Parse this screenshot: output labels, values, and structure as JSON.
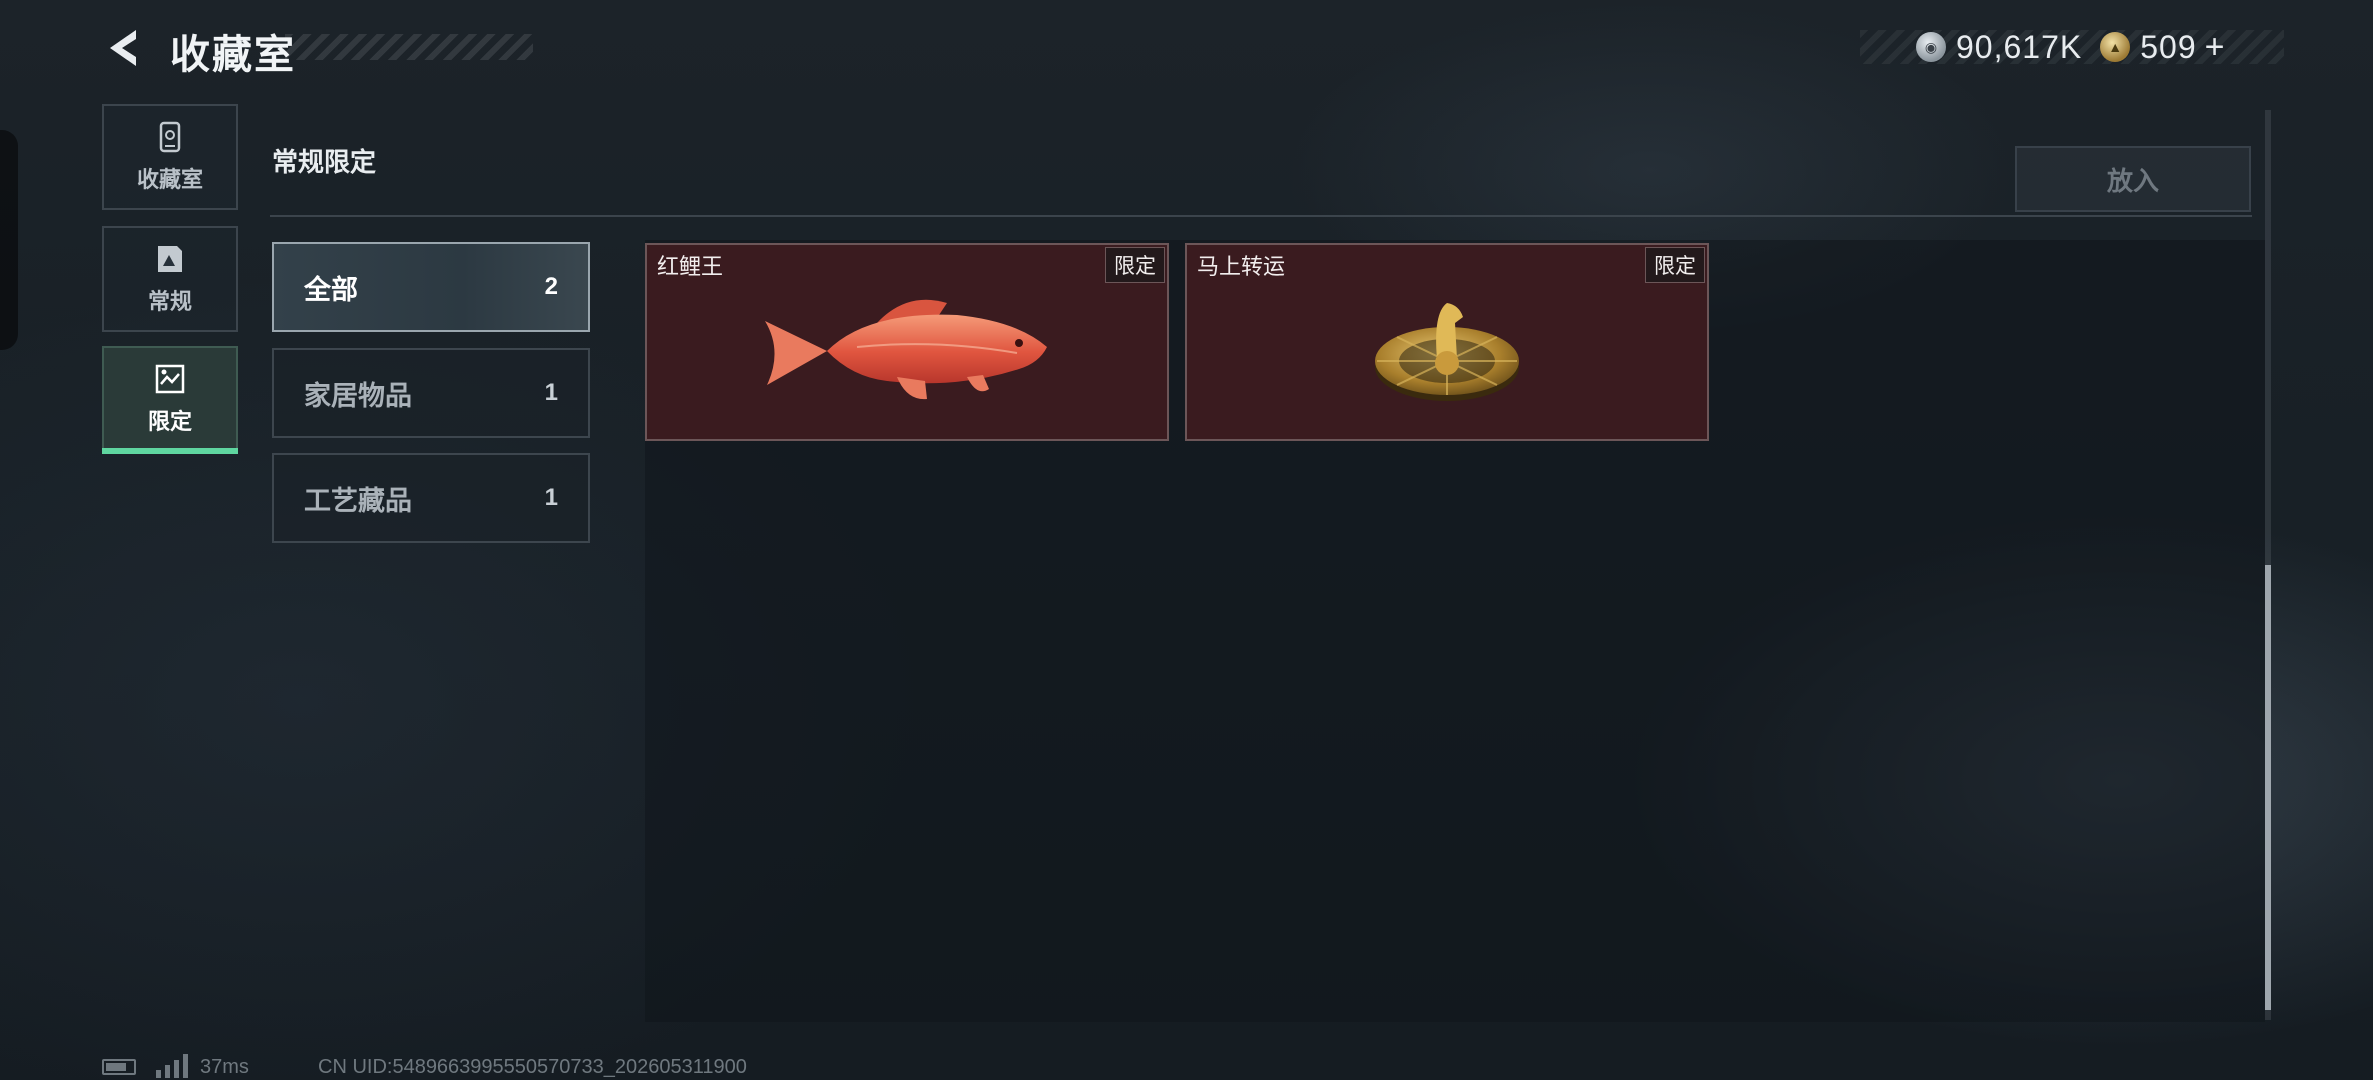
{
  "header": {
    "title": "收藏室"
  },
  "currency": [
    {
      "name": "silver-coin",
      "value": "90,617K"
    },
    {
      "name": "gold-coin",
      "value": "509"
    }
  ],
  "currency_add": "+",
  "sidebar": {
    "items": [
      {
        "label": "收藏室",
        "icon": "collection-icon",
        "active": false
      },
      {
        "label": "常规",
        "icon": "regular-icon",
        "active": false
      },
      {
        "label": "限定",
        "icon": "limited-icon",
        "active": true
      }
    ]
  },
  "section": {
    "title": "常规限定",
    "put_button": "放入"
  },
  "filters": [
    {
      "label": "全部",
      "count": "2",
      "active": true
    },
    {
      "label": "家居物品",
      "count": "1",
      "active": false
    },
    {
      "label": "工艺藏品",
      "count": "1",
      "active": false
    }
  ],
  "items": [
    {
      "name": "红鲤王",
      "tag": "限定",
      "icon": "red-carp-icon"
    },
    {
      "name": "马上转运",
      "tag": "限定",
      "icon": "horse-fortune-disc-icon"
    }
  ],
  "status": {
    "ping": "37ms",
    "uid": "CN UID:5489663995550570733_202605311900"
  }
}
